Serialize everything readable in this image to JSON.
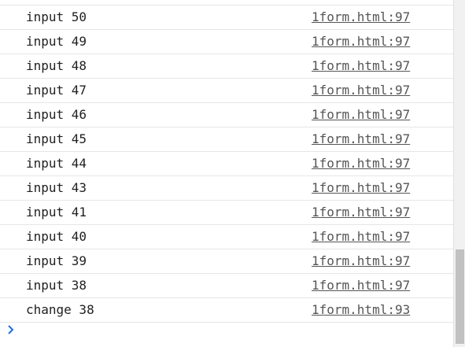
{
  "console": {
    "messages": [
      {
        "text": "input 50",
        "source": "1form.html:97"
      },
      {
        "text": "input 49",
        "source": "1form.html:97"
      },
      {
        "text": "input 48",
        "source": "1form.html:97"
      },
      {
        "text": "input 47",
        "source": "1form.html:97"
      },
      {
        "text": "input 46",
        "source": "1form.html:97"
      },
      {
        "text": "input 45",
        "source": "1form.html:97"
      },
      {
        "text": "input 44",
        "source": "1form.html:97"
      },
      {
        "text": "input 43",
        "source": "1form.html:97"
      },
      {
        "text": "input 41",
        "source": "1form.html:97"
      },
      {
        "text": "input 40",
        "source": "1form.html:97"
      },
      {
        "text": "input 39",
        "source": "1form.html:97"
      },
      {
        "text": "input 38",
        "source": "1form.html:97"
      },
      {
        "text": "change 38",
        "source": "1form.html:93"
      }
    ],
    "prompt_icon": "chevron-right-icon",
    "prompt_value": ""
  },
  "colors": {
    "prompt_accent": "#1a73e8",
    "link": "#555555",
    "divider": "#e6e6e6",
    "scrollbar_track": "#f1f1f1",
    "scrollbar_thumb": "#c1c1c1"
  }
}
